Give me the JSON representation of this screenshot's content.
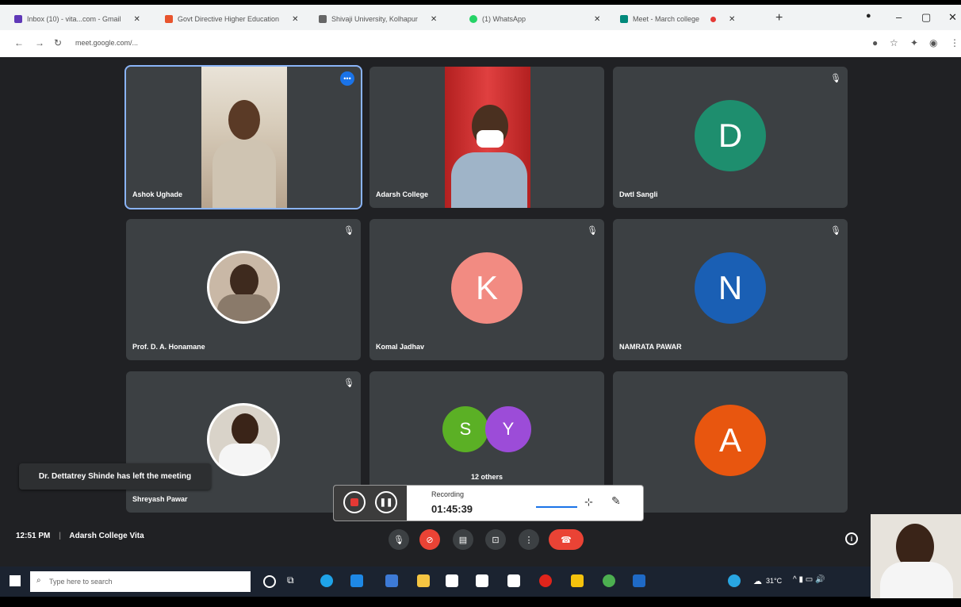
{
  "browser": {
    "tabs": [
      {
        "label": "Inbox (10) - vita...com - Gmail",
        "color": "#5f38b7"
      },
      {
        "label": "Govt Directive Higher Education",
        "color": "#e8542d"
      },
      {
        "label": "Shivaji University, Kolhapur",
        "color": "#666666"
      },
      {
        "label": "(1) WhatsApp",
        "color": "#25d366"
      },
      {
        "label": "Meet - March college",
        "color": "#00897b"
      }
    ],
    "url": "meet.google.com/..."
  },
  "meeting": {
    "participants": [
      {
        "name": "Ashok Ughade",
        "type": "video"
      },
      {
        "name": "Adarsh College",
        "type": "video"
      },
      {
        "name": "Dwtl Sangli",
        "initial": "D",
        "color": "#1e8e6e"
      },
      {
        "name": "Prof. D. A. Honamane",
        "type": "photo"
      },
      {
        "name": "Komal Jadhav",
        "initial": "K",
        "color": "#f28b82"
      },
      {
        "name": "NAMRATA PAWAR",
        "initial": "N",
        "color": "#1a5fb4"
      },
      {
        "name": "Shreyash Pawar",
        "type": "photo"
      },
      {
        "group": "12 others",
        "initials": [
          "S",
          "Y"
        ],
        "colors": [
          "#5bb025",
          "#9c4cd8"
        ]
      },
      {
        "initial": "A",
        "color": "#e8560f"
      }
    ],
    "toast": "Dr. Dettatrey Shinde has left the meeting",
    "recording": {
      "label": "Recording",
      "time": "01:45:39"
    },
    "time": "12:51 PM",
    "title": "Adarsh College Vita"
  },
  "taskbar": {
    "search_placeholder": "Type here to search",
    "tray": "31°C"
  }
}
